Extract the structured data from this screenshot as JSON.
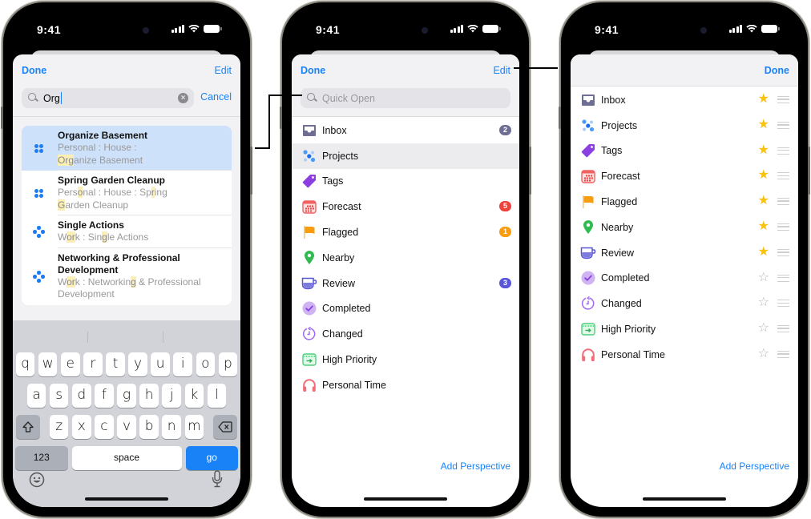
{
  "status_bar": {
    "time": "9:41"
  },
  "colors": {
    "accent": "#1a82f7",
    "selected_row": "#cde1fb",
    "highlight": "#fbefb6",
    "star_on": "#f8c20f",
    "badge_inbox": "#6e6e93",
    "badge_forecast": "#f0413a",
    "badge_flagged": "#f99c0e",
    "badge_review": "#5856d6"
  },
  "screen1": {
    "nav": {
      "done_label": "Done",
      "edit_label": "Edit"
    },
    "search": {
      "value": "Org",
      "clear_icon": "clear-circle-icon",
      "cancel_label": "Cancel"
    },
    "results": [
      {
        "title": "Organize Basement",
        "icon": "folder-project-icon",
        "path_segments": [
          {
            "text": "Personal : House :",
            "hl": false
          },
          {
            "break": true
          },
          {
            "text": "Org",
            "hl": true
          },
          {
            "text": "anize Basement",
            "hl": false
          }
        ],
        "selected": true
      },
      {
        "title": "Spring Garden Cleanup",
        "icon": "folder-project-icon",
        "path_segments": [
          {
            "text": "Pers",
            "hl": false
          },
          {
            "text": "o",
            "hl": true
          },
          {
            "text": "nal : House : Sp",
            "hl": false
          },
          {
            "text": "r",
            "hl": true
          },
          {
            "text": "ing",
            "hl": false
          },
          {
            "break": true
          },
          {
            "text": "G",
            "hl": true
          },
          {
            "text": "arden Cleanup",
            "hl": false
          }
        ],
        "selected": false
      },
      {
        "title": "Single Actions",
        "icon": "single-actions-icon",
        "path_segments": [
          {
            "text": "W",
            "hl": false
          },
          {
            "text": "or",
            "hl": true
          },
          {
            "text": "k : Sin",
            "hl": false
          },
          {
            "text": "g",
            "hl": true
          },
          {
            "text": "le Actions",
            "hl": false
          }
        ],
        "selected": false
      },
      {
        "title": "Networking & Professional Development",
        "icon": "single-actions-icon",
        "path_segments": [
          {
            "text": "W",
            "hl": false
          },
          {
            "text": "or",
            "hl": true
          },
          {
            "text": "k : Networkin",
            "hl": false
          },
          {
            "text": "g",
            "hl": true
          },
          {
            "text": " & Professional",
            "hl": false
          },
          {
            "break": true
          },
          {
            "text": "Development",
            "hl": false
          }
        ],
        "selected": false
      }
    ],
    "keyboard": {
      "row1": [
        "q",
        "w",
        "e",
        "r",
        "t",
        "y",
        "u",
        "i",
        "o",
        "p"
      ],
      "row2": [
        "a",
        "s",
        "d",
        "f",
        "g",
        "h",
        "j",
        "k",
        "l"
      ],
      "row3": [
        "z",
        "x",
        "c",
        "v",
        "b",
        "n",
        "m"
      ],
      "numbers_label": "123",
      "space_label": "space",
      "go_label": "go"
    }
  },
  "screen2": {
    "nav": {
      "done_label": "Done",
      "edit_label": "Edit"
    },
    "search": {
      "placeholder": "Quick Open"
    },
    "perspectives": [
      {
        "label": "Inbox",
        "icon": "inbox-icon",
        "badge": "2",
        "badge_color": "#6e6e93",
        "selected": false
      },
      {
        "label": "Projects",
        "icon": "projects-icon",
        "badge": null,
        "selected": true
      },
      {
        "label": "Tags",
        "icon": "tag-icon",
        "badge": null,
        "selected": false
      },
      {
        "label": "Forecast",
        "icon": "forecast-calendar-icon",
        "badge": "5",
        "badge_color": "#f0413a",
        "selected": false
      },
      {
        "label": "Flagged",
        "icon": "flag-icon",
        "badge": "1",
        "badge_color": "#f99c0e",
        "selected": false
      },
      {
        "label": "Nearby",
        "icon": "location-pin-icon",
        "badge": null,
        "selected": false
      },
      {
        "label": "Review",
        "icon": "review-cup-icon",
        "badge": "3",
        "badge_color": "#5856d6",
        "selected": false
      },
      {
        "label": "Completed",
        "icon": "checkmark-circle-icon",
        "badge": null,
        "selected": false
      },
      {
        "label": "Changed",
        "icon": "clock-arrow-icon",
        "badge": null,
        "selected": false
      },
      {
        "label": "High Priority",
        "icon": "priority-calendar-icon",
        "badge": null,
        "selected": false
      },
      {
        "label": "Personal Time",
        "icon": "headphones-icon",
        "badge": null,
        "selected": false
      }
    ],
    "add_perspective_label": "Add Perspective"
  },
  "screen3": {
    "nav": {
      "done_label": "Done"
    },
    "perspectives": [
      {
        "label": "Inbox",
        "icon": "inbox-icon",
        "favorite": true
      },
      {
        "label": "Projects",
        "icon": "projects-icon",
        "favorite": true
      },
      {
        "label": "Tags",
        "icon": "tag-icon",
        "favorite": true
      },
      {
        "label": "Forecast",
        "icon": "forecast-calendar-icon",
        "favorite": true
      },
      {
        "label": "Flagged",
        "icon": "flag-icon",
        "favorite": true
      },
      {
        "label": "Nearby",
        "icon": "location-pin-icon",
        "favorite": true
      },
      {
        "label": "Review",
        "icon": "review-cup-icon",
        "favorite": true
      },
      {
        "label": "Completed",
        "icon": "checkmark-circle-icon",
        "favorite": false
      },
      {
        "label": "Changed",
        "icon": "clock-arrow-icon",
        "favorite": false
      },
      {
        "label": "High Priority",
        "icon": "priority-calendar-icon",
        "favorite": false
      },
      {
        "label": "Personal Time",
        "icon": "headphones-icon",
        "favorite": false
      }
    ],
    "add_perspective_label": "Add Perspective"
  }
}
